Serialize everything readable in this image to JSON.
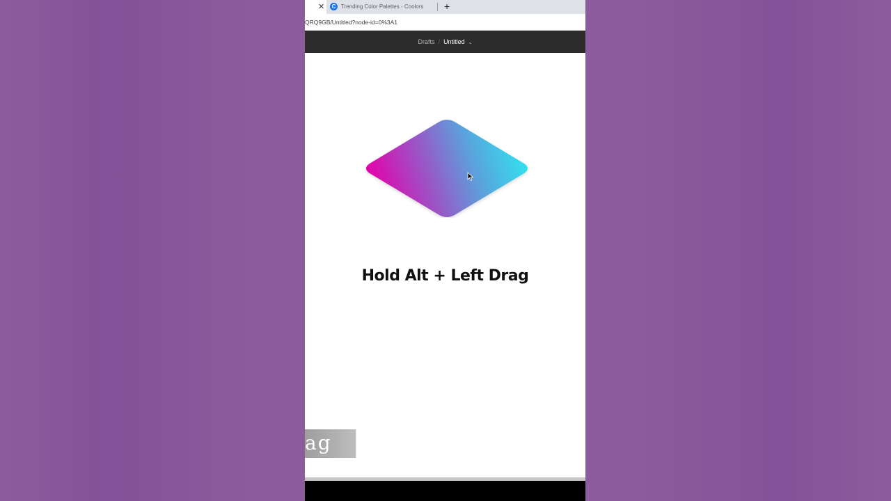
{
  "browser": {
    "active_tab": {
      "close_glyph": "✕"
    },
    "tabs": [
      {
        "title": "Trending Color Palettes - Coolors",
        "favicon_letter": "C",
        "favicon_color": "#1a73e8"
      }
    ],
    "new_tab_glyph": "+",
    "url": "QRQ9GB/Untitled?node-id=0%3A1"
  },
  "header": {
    "breadcrumb_root": "Drafts",
    "breadcrumb_separator": "/",
    "file_name": "Untitled",
    "file_menu_icon": "chevron-down-icon"
  },
  "canvas": {
    "shape": {
      "type": "rounded diamond",
      "gradient_colors": [
        "#e600a8",
        "#9b54c5",
        "#5ca0dc",
        "#2ee6ee"
      ]
    },
    "caption": "Hold Alt + Left Drag",
    "overlay_text": "ag"
  },
  "colors": {
    "background": "#8c5c9c",
    "toolbar": "#2c2c2c",
    "canvas": "#ffffff"
  }
}
